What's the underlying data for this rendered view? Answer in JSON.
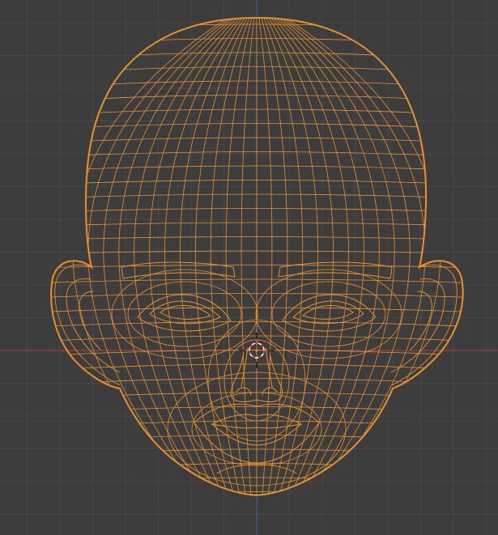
{
  "viewport": {
    "view": "front",
    "shading": "wireframe",
    "background_color": "#3d3d3d",
    "grid_color": "#484848",
    "x_axis_color": "#b4434b",
    "z_axis_color": "#3c62a6",
    "selection_color": "#e8912f",
    "object": {
      "name": "head-mesh",
      "selected": true
    },
    "cursor": {
      "type": "3d-cursor"
    }
  }
}
